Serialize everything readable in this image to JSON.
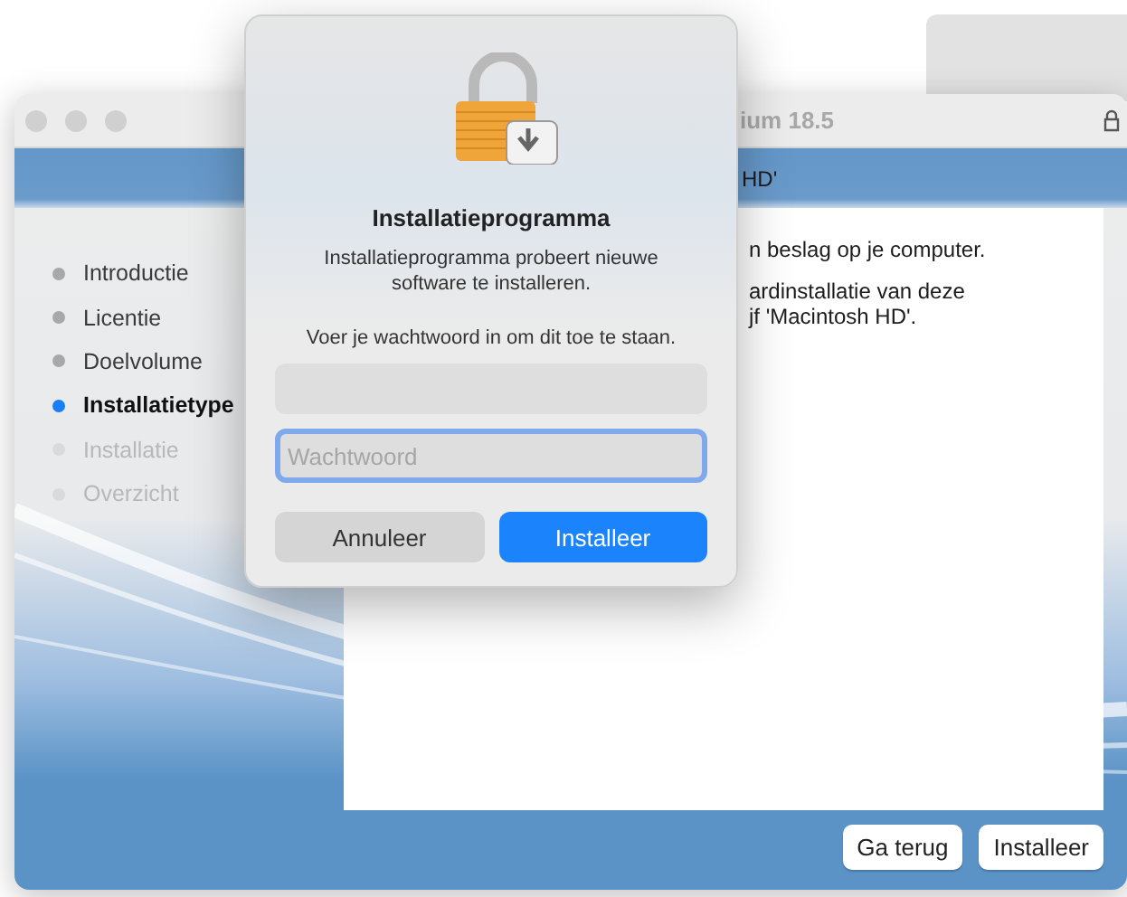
{
  "background_window": {
    "present": true
  },
  "installer_window": {
    "title": "ium 18.5",
    "header": "HD'",
    "steps": [
      {
        "label": "Introductie",
        "selected": false,
        "disabled": false
      },
      {
        "label": "Licentie",
        "selected": false,
        "disabled": false
      },
      {
        "label": "Doelvolume",
        "selected": false,
        "disabled": false
      },
      {
        "label": "Installatietype",
        "selected": true,
        "disabled": false
      },
      {
        "label": "Installatie",
        "selected": false,
        "disabled": true
      },
      {
        "label": "Overzicht",
        "selected": false,
        "disabled": true
      }
    ],
    "content": [
      {
        "lines": [
          "n beslag op je computer."
        ]
      },
      {
        "lines": [
          "ardinstallatie van deze",
          "jf 'Macintosh HD'."
        ]
      }
    ],
    "buttons": [
      {
        "label": "Ga terug"
      },
      {
        "label": "Installeer"
      }
    ]
  },
  "dialog": {
    "title": "Installatieprogramma",
    "message": "Installatieprogramma probeert nieuwe software te installeren.",
    "prompt": "Voer je wachtwoord in om dit toe te staan.",
    "fields": [
      {
        "kind": "username",
        "focused": false
      },
      {
        "kind": "password",
        "placeholder": "Wachtwoord",
        "focused": true
      }
    ],
    "buttons": [
      {
        "label": "Annuleer",
        "kind": "cancel"
      },
      {
        "label": "Installeer",
        "kind": "default"
      }
    ]
  }
}
